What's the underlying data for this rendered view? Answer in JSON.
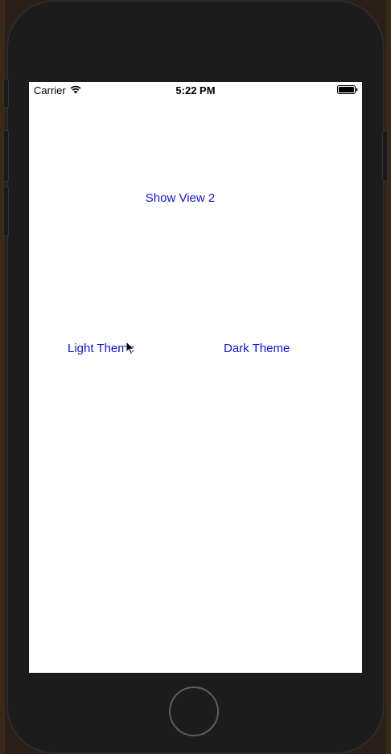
{
  "status_bar": {
    "carrier": "Carrier",
    "time": "5:22 PM",
    "wifi_icon": "wifi-icon",
    "battery_icon": "battery-full-icon"
  },
  "buttons": {
    "show_view_2": "Show View 2",
    "light_theme": "Light Theme",
    "dark_theme": "Dark Theme"
  },
  "colors": {
    "button_tint": "#1515c8",
    "device_body": "#1c1c1c",
    "screen_background": "#ffffff"
  }
}
